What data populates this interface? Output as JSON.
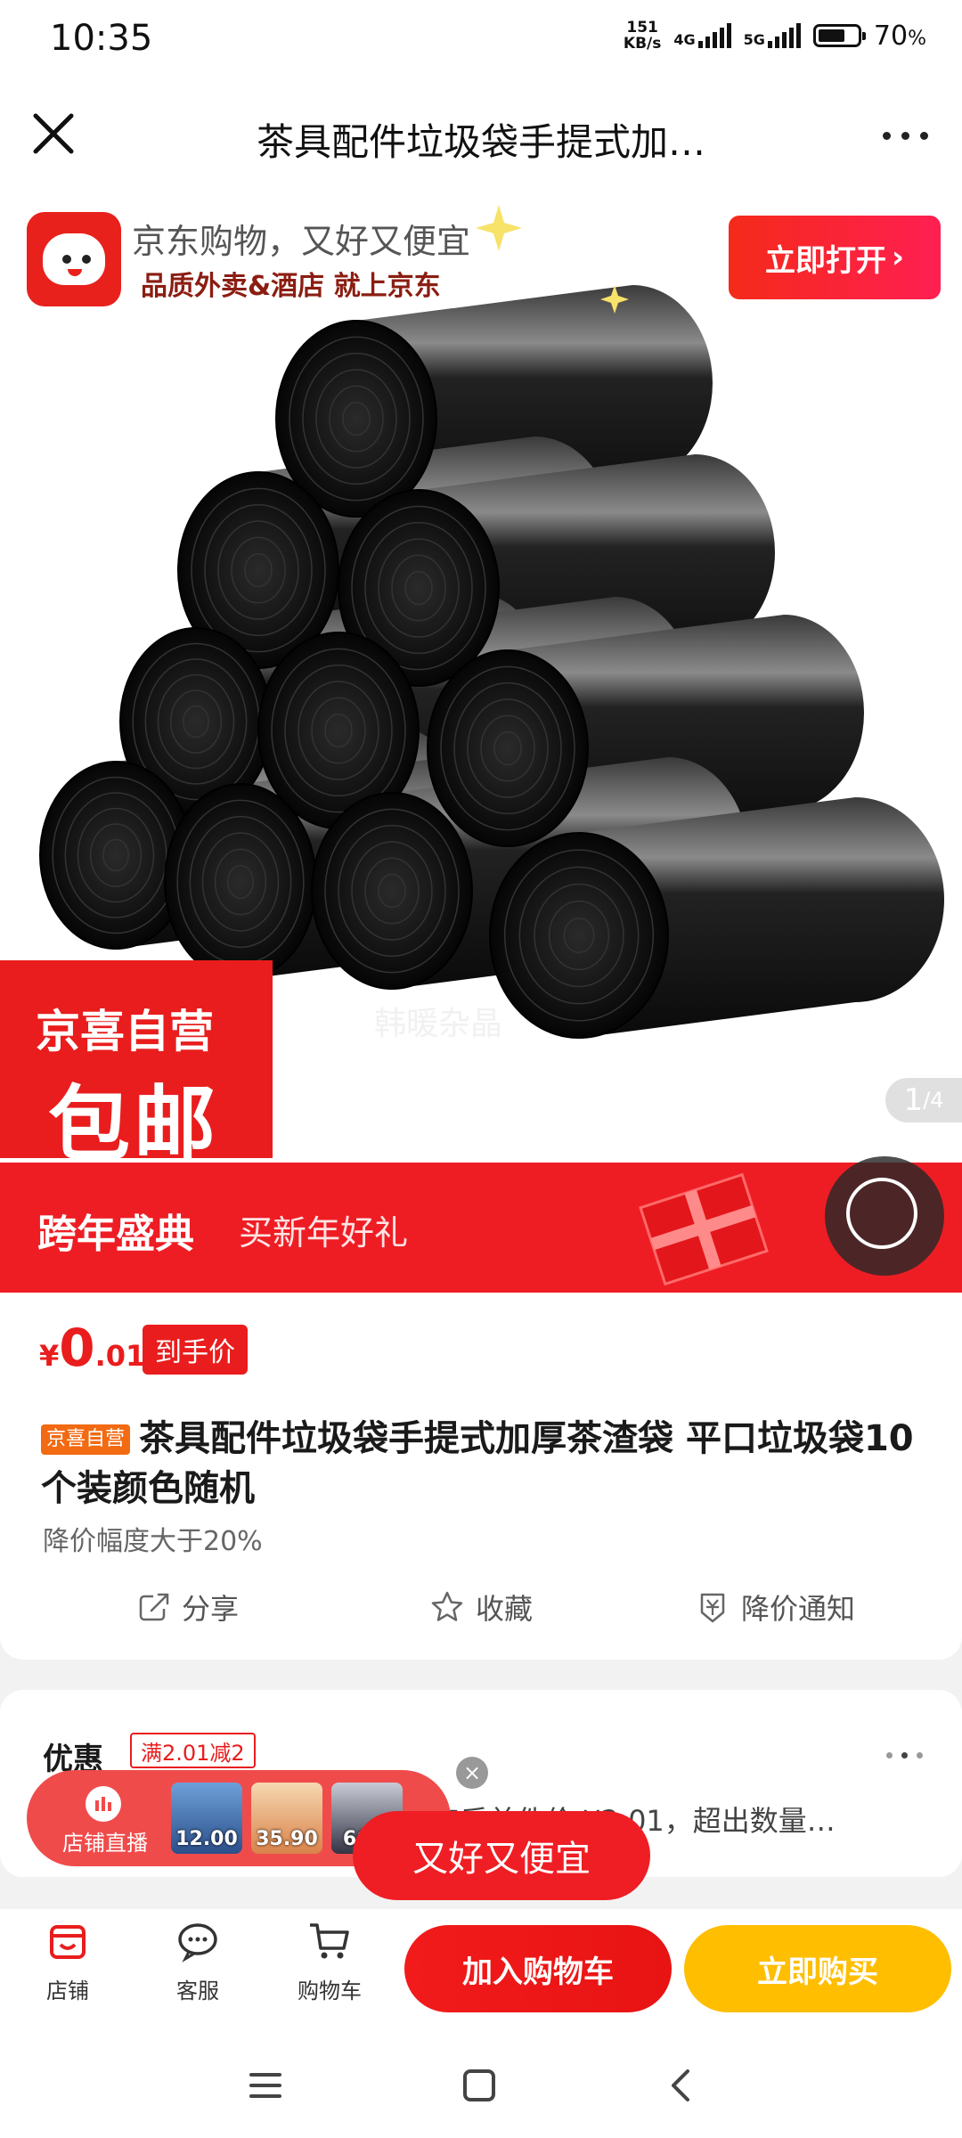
{
  "status_bar": {
    "time": "10:35",
    "net_speed_value": "151",
    "net_speed_unit": "KB/s",
    "signal1": "4G",
    "signal2": "5G",
    "battery_percent": 70,
    "battery_text": "70",
    "battery_unit": "%"
  },
  "nav": {
    "title": "茶具配件垃圾袋手提式加…"
  },
  "ad_banner": {
    "line1": "京东购物，又好又便宜",
    "line2": "品质外卖&酒店 就上京东",
    "open_button": "立即打开",
    "open_arrow": "›"
  },
  "gallery": {
    "badge_line1": "京喜自营",
    "badge_line2": "包邮",
    "watermark": "韩暖杂晶",
    "pager_current": "1",
    "pager_total": "/4"
  },
  "promo_strip": {
    "title": "跨年盛典",
    "subtitle": "买新年好礼"
  },
  "product": {
    "currency": "¥",
    "price_int": "0",
    "price_dec": ".01",
    "price_tag": "到手价",
    "self_tag": "京喜自营",
    "title": "茶具配件垃圾袋手提式加厚茶渣袋 平口垃圾袋10个装颜色随机",
    "price_note": "降价幅度大于20%",
    "actions": {
      "share": "分享",
      "favorite": "收藏",
      "notify": "降价通知"
    }
  },
  "discount": {
    "label": "优惠",
    "tag": "满2.01减2",
    "desc": "实后单件价 ¥2.01，超出数量…"
  },
  "live_widget": {
    "label": "店铺直播",
    "thumbs": [
      "12.00",
      "35.90",
      "66.9"
    ]
  },
  "slogan": "又好又便宜",
  "bottom_bar": {
    "store": "店铺",
    "service": "客服",
    "cart": "购物车",
    "add_to_cart": "加入购物车",
    "buy_now": "立即购买"
  },
  "colors": {
    "brand_red": "#e91d1d",
    "buy_yellow": "#ffbe00",
    "tag_orange": "#f26a12"
  }
}
